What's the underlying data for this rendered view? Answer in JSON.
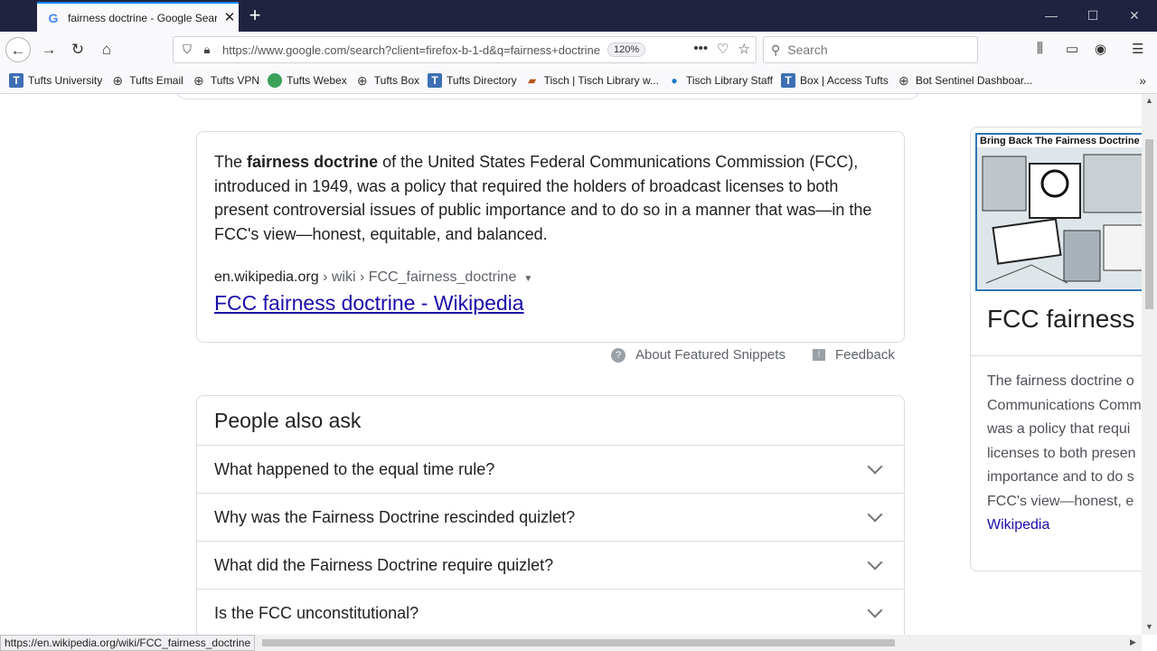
{
  "browser": {
    "tab": {
      "title": "fairness doctrine - Google Search",
      "favicon": "google-g-icon"
    },
    "new_tab_icon": "+",
    "window_controls": [
      "minimize",
      "maximize",
      "close"
    ],
    "url": "https://www.google.com/search?client=firefox-b-1-d&q=fairness+doctrine",
    "zoom": "120%",
    "search_placeholder": "Search",
    "bookmarks": [
      {
        "label": "Tufts University",
        "icon": "T"
      },
      {
        "label": "Tufts Email",
        "icon": "globe"
      },
      {
        "label": "Tufts VPN",
        "icon": "globe"
      },
      {
        "label": "Tufts Webex",
        "icon": "webex"
      },
      {
        "label": "Tufts Box",
        "icon": "globe"
      },
      {
        "label": "Tufts Directory",
        "icon": "T"
      },
      {
        "label": "Tisch | Tisch Library w...",
        "icon": "tisch"
      },
      {
        "label": "Tisch Library Staff",
        "icon": "drupal"
      },
      {
        "label": "Box | Access Tufts",
        "icon": "T"
      },
      {
        "label": "Bot Sentinel Dashboar...",
        "icon": "globe"
      }
    ],
    "status_url": "https://en.wikipedia.org/wiki/FCC_fairness_doctrine"
  },
  "snippet": {
    "text_before": "The ",
    "text_bold": "fairness doctrine",
    "text_after": " of the United States Federal Communications Commission (FCC), introduced in 1949, was a policy that required the holders of broadcast licenses to both present controversial issues of public importance and to do so in a manner that was—in the FCC's view—honest, equitable, and balanced.",
    "cite_domain": "en.wikipedia.org",
    "cite_path": " › wiki › FCC_fairness_doctrine",
    "cite_dropdown": "▼",
    "link_title": "FCC fairness doctrine - Wikipedia",
    "about_label": "About Featured Snippets",
    "feedback_label": "Feedback"
  },
  "people_also_ask": {
    "title": "People also ask",
    "questions": [
      "What happened to the equal time rule?",
      "Why was the Fairness Doctrine rescinded quizlet?",
      "What did the Fairness Doctrine require quizlet?",
      "Is the FCC unconstitutional?"
    ]
  },
  "knowledge_panel": {
    "image_caption": "Bring Back The Fairness Doctrine",
    "title": "FCC fairness",
    "desc_lines": [
      "The fairness doctrine o",
      "Communications Comm",
      "was a policy that requi",
      "licenses to both presen",
      "importance and to do s",
      "FCC's view—honest, e"
    ],
    "source": "Wikipedia"
  },
  "colors": {
    "link": "#1a0dab",
    "tabbar": "#202340",
    "accent": "#0a84ff"
  }
}
